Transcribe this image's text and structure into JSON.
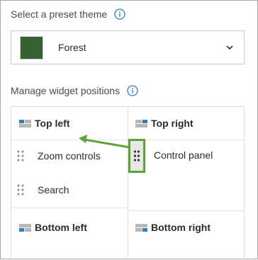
{
  "theme": {
    "label": "Select a preset theme",
    "selected": "Forest",
    "swatch_color": "#376034"
  },
  "widgets": {
    "label": "Manage widget positions",
    "zones": {
      "top_left": "Top left",
      "top_right": "Top right",
      "bottom_left": "Bottom left",
      "bottom_right": "Bottom right"
    },
    "items": {
      "zoom": "Zoom controls",
      "search": "Search",
      "control_panel": "Control panel"
    }
  },
  "colors": {
    "accent_green": "#5fa336",
    "info_blue": "#2f7fc1",
    "icon_blue": "#2f7fc1",
    "icon_gray": "#9a9a9a"
  }
}
